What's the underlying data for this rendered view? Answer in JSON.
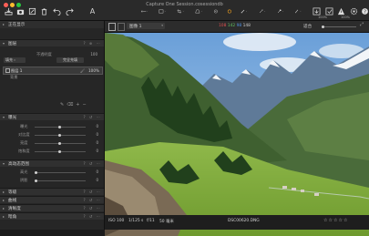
{
  "window": {
    "title": "Capture One Session.cosessiondb"
  },
  "toolbar": {
    "sizes": [
      "100%",
      "100%"
    ]
  },
  "viewer": {
    "collection": "图像 1",
    "readouts": {
      "r": "108",
      "g": "142",
      "b": "98",
      "l": "148"
    },
    "fit_label": "适合"
  },
  "sidebar": {
    "header_label": "正在显示",
    "layers": {
      "title": "图层",
      "opacity_label": "不透明度",
      "opacity_value": "100",
      "fill_label": "填充",
      "fill_value": "完全充填",
      "layer_name": "图层 1",
      "layer_opacity": "100%",
      "background_label": "背景"
    },
    "exposure": {
      "title": "曝光",
      "rows": [
        {
          "label": "曝光",
          "value": "0"
        },
        {
          "label": "对比度",
          "value": "0"
        },
        {
          "label": "亮度",
          "value": "0"
        },
        {
          "label": "饱和度",
          "value": "0"
        }
      ]
    },
    "hdr": {
      "title": "高动态范围",
      "rows": [
        {
          "label": "高光",
          "value": "0"
        },
        {
          "label": "阴影",
          "value": "0"
        }
      ]
    },
    "sections": [
      "等级",
      "曲线",
      "清晰度",
      "暗角"
    ]
  },
  "status": {
    "iso": "ISO 100",
    "shutter": "1/125 s",
    "aperture": "f/11",
    "focal": "50 毫米",
    "filename": "DSC00620.DNG"
  },
  "colors": {
    "accent": "#f0a020",
    "selected_layer": "#3a3a3a",
    "panel": "#262626",
    "titlebar": "#2a2a2a"
  }
}
